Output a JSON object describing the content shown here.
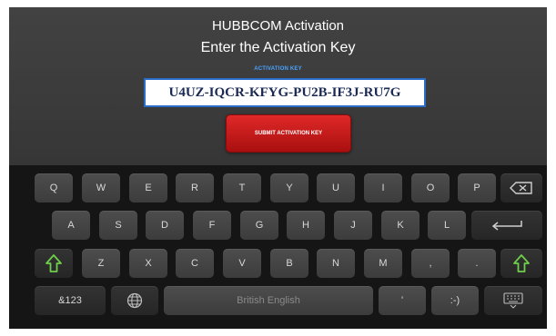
{
  "header": {
    "title": "HUBBCOM Activation",
    "subtitle": "Enter the Activation Key"
  },
  "activation": {
    "field_label": "ACTIVATION KEY",
    "key_value": "U4UZ-IQCR-KFYG-PU2B-IF3J-RU7G",
    "submit_label": "SUBMIT ACTIVATION KEY"
  },
  "keyboard": {
    "row1": [
      "Q",
      "W",
      "E",
      "R",
      "T",
      "Y",
      "U",
      "I",
      "O",
      "P"
    ],
    "row2": [
      "A",
      "S",
      "D",
      "F",
      "G",
      "H",
      "J",
      "K",
      "L"
    ],
    "row3": [
      "Z",
      "X",
      "C",
      "V",
      "B",
      "N",
      "M",
      ",",
      "."
    ],
    "symbols_label": "&123",
    "language_label": "British English",
    "apostrophe_label": "'",
    "emoticon_label": ":-)",
    "icons": {
      "backspace": "backspace-icon",
      "enter": "enter-icon",
      "shift": "shift-icon",
      "globe": "globe-icon",
      "hide_keyboard": "keyboard-hide-icon"
    }
  },
  "colors": {
    "submit": "#c81a1a",
    "shift_icon": "#6fcf4a",
    "key_label_accent": "#4aa3ff",
    "input_border": "#2a6dc9"
  }
}
